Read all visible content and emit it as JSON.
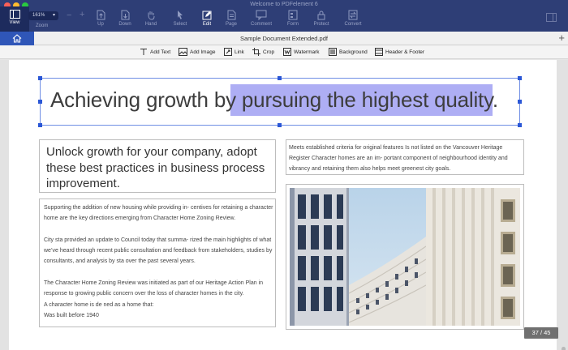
{
  "window": {
    "title": "Welcome to PDFelement 6"
  },
  "toolbar": {
    "view_label": "View",
    "zoom_value": "161%",
    "zoom_label": "Zoom",
    "up_label": "Up",
    "down_label": "Down",
    "hand_label": "Hand",
    "select_label": "Select",
    "edit_label": "Edit",
    "page_label": "Page",
    "comment_label": "Comment",
    "form_label": "Form",
    "protect_label": "Protect",
    "convert_label": "Convert",
    "minus": "−",
    "plus": "+"
  },
  "tabs": {
    "document": "Sample Document Extended.pdf",
    "add": "+"
  },
  "edit_toolbar": {
    "add_text": "Add Text",
    "add_image": "Add Image",
    "link": "Link",
    "crop": "Crop",
    "watermark": "Watermark",
    "background": "Background",
    "header_footer": "Header & Footer"
  },
  "document": {
    "headline_plain": "Achieving growth by",
    "headline_highlighted": "pursuing the highest quality.",
    "callout": "Unlock growth for your company, adopt these best practices in business process improvement.",
    "criteria_text": "Meets established criteria for original features Is not listed on the Vancouver Heritage Register Character homes are an im- portant component of neighbourhood identity and vibrancy and retaining them also helps meet greenest city goals.",
    "body": {
      "p1": "Supporting the addition of new housing while providing in- centives for retaining a character home are the key directions emerging from Character Home Zoning Review.",
      "p2": "City sta  provided an update to Council today that summa- rized the main highlights of what we’ve heard through recent public consultation and feedback from stakeholders, studies by consultants, and analysis by sta  over the past several years.",
      "p3": "The Character Home Zoning Review was initiated as part of our Heritage Action Plan in response to growing public concern over the loss of character homes in the city.",
      "p4": "A character home is de ned as a home that:",
      "p5": "Was built before 1940"
    }
  },
  "pagination": {
    "indicator": "37 / 45"
  },
  "colors": {
    "toolbar_bg": "#2e3e76",
    "accent_blue": "#2f56b8",
    "highlight": "#aeaef4",
    "selection": "#2b57d6"
  }
}
